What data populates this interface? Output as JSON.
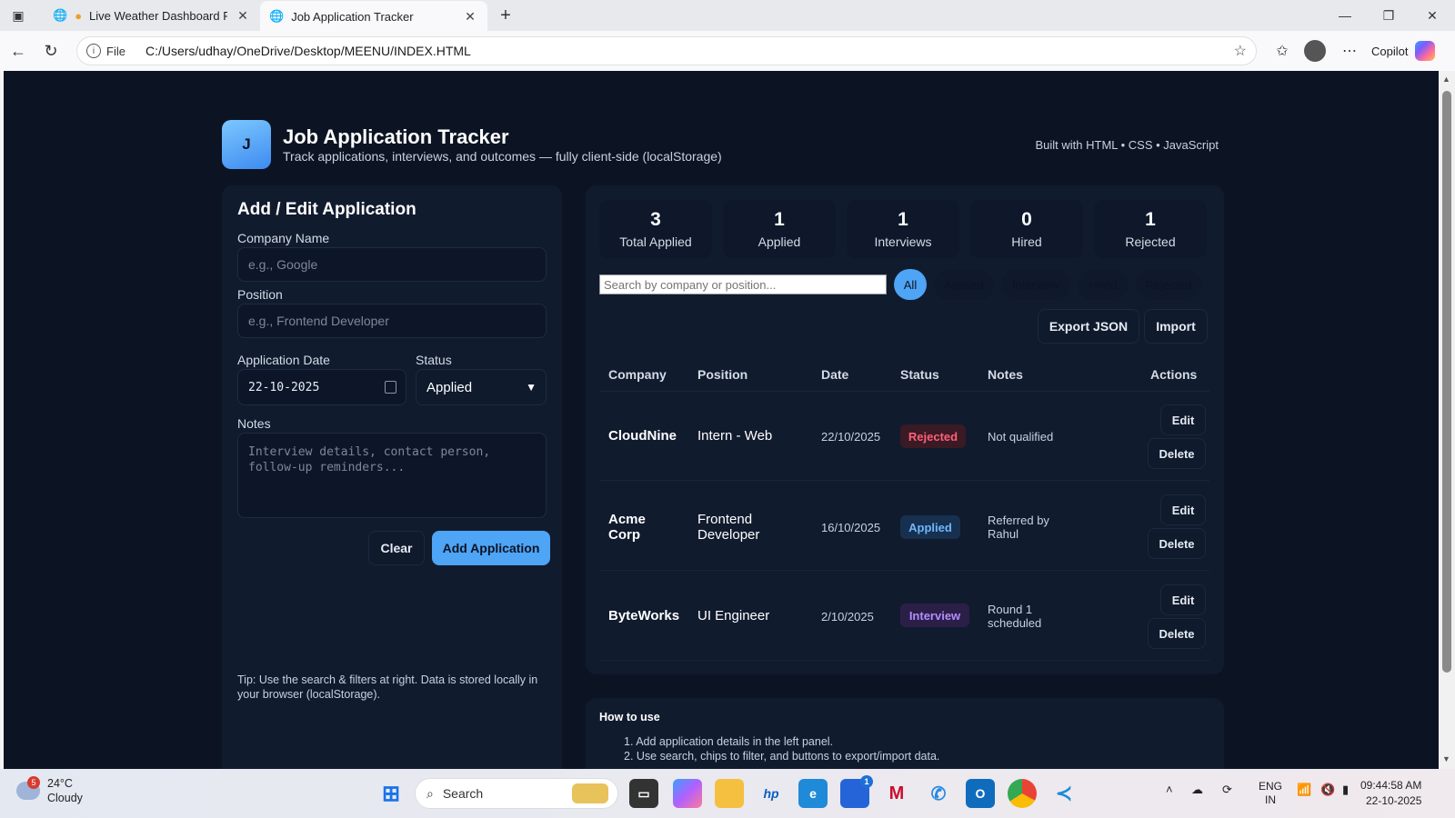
{
  "browser": {
    "tabs": [
      {
        "title": "Live Weather Dashboard Proje",
        "active": false
      },
      {
        "title": "Job Application Tracker",
        "active": true
      }
    ],
    "file_label": "File",
    "url": "C:/Users/udhay/OneDrive/Desktop/MEENU/INDEX.HTML",
    "copilot_label": "Copilot"
  },
  "app": {
    "logo_letter": "J",
    "title": "Job Application Tracker",
    "subtitle": "Track applications, interviews, and outcomes — fully client-side (localStorage)",
    "built_with": "Built with HTML • CSS • JavaScript"
  },
  "form": {
    "heading": "Add / Edit Application",
    "company_label": "Company Name",
    "company_placeholder": "e.g., Google",
    "position_label": "Position",
    "position_placeholder": "e.g., Frontend Developer",
    "date_label": "Application Date",
    "date_value": "22-10-2025",
    "status_label": "Status",
    "status_value": "Applied",
    "notes_label": "Notes",
    "notes_placeholder": "Interview details, contact person,\nfollow-up reminders...",
    "clear_label": "Clear",
    "submit_label": "Add Application",
    "tip": "Tip: Use the search & filters at right. Data is stored locally in your browser (localStorage)."
  },
  "stats": [
    {
      "value": "3",
      "label": "Total Applied"
    },
    {
      "value": "1",
      "label": "Applied"
    },
    {
      "value": "1",
      "label": "Interviews"
    },
    {
      "value": "0",
      "label": "Hired"
    },
    {
      "value": "1",
      "label": "Rejected"
    }
  ],
  "filters": {
    "search_placeholder": "Search by company or position...",
    "chips": [
      "All",
      "Applied",
      "Interview",
      "Hired",
      "Rejected"
    ],
    "active_chip": "All",
    "export_label": "Export JSON",
    "import_label": "Import"
  },
  "table": {
    "headers": [
      "Company",
      "Position",
      "Date",
      "Status",
      "Notes",
      "Actions"
    ],
    "rows": [
      {
        "company": "CloudNine",
        "position": "Intern - Web",
        "date": "22/10/2025",
        "status": "Rejected",
        "notes": "Not qualified",
        "edit": "Edit",
        "delete": "Delete"
      },
      {
        "company": "Acme Corp",
        "position": "Frontend Developer",
        "date": "16/10/2025",
        "status": "Applied",
        "notes": "Referred by Rahul",
        "edit": "Edit",
        "delete": "Delete"
      },
      {
        "company": "ByteWorks",
        "position": "UI Engineer",
        "date": "2/10/2025",
        "status": "Interview",
        "notes": "Round 1 scheduled",
        "edit": "Edit",
        "delete": "Delete"
      }
    ],
    "status_colors": {
      "Rejected": {
        "bg": "#3a1a24",
        "fg": "#ff5f7a"
      },
      "Applied": {
        "bg": "#17304f",
        "fg": "#6fb6ff"
      },
      "Interview": {
        "bg": "#2b1f47",
        "fg": "#b58cff"
      }
    }
  },
  "howto": {
    "title": "How to use",
    "steps": [
      "1. Add application details in the left panel.",
      "2. Use search, chips to filter, and buttons to export/import data."
    ]
  },
  "taskbar": {
    "weather_temp": "24°C",
    "weather_desc": "Cloudy",
    "weather_badge": "5",
    "search_label": "Search",
    "lang_line1": "ENG",
    "lang_line2": "IN",
    "time": "09:44:58 AM",
    "date": "22-10-2025",
    "store_badge": "1"
  },
  "colors": {
    "accent": "#4ea4f5",
    "page_bg": "#0c1424",
    "panel_bg": "#111b2e"
  }
}
